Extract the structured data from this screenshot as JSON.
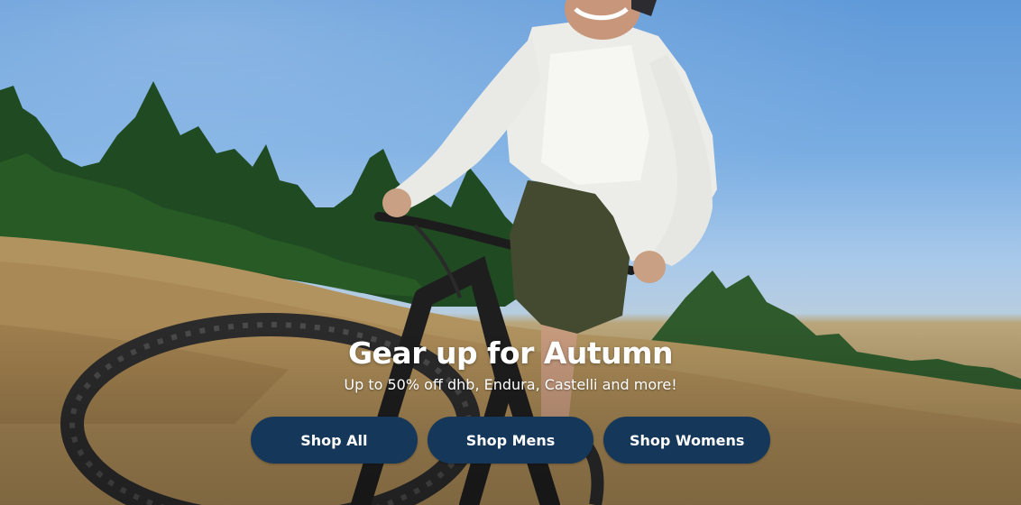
{
  "hero": {
    "headline": "Gear up for Autumn",
    "subheadline": "Up to 50% off dhb, Endura, Castelli and more!",
    "image_subject": "woman riding mountain bike on grassy hillside",
    "buttons": [
      {
        "label": "Shop All"
      },
      {
        "label": "Shop Mens"
      },
      {
        "label": "Shop Womens"
      }
    ]
  },
  "colors": {
    "button_bg": "#15385a",
    "button_text": "#ffffff",
    "headline_text": "#ffffff"
  }
}
